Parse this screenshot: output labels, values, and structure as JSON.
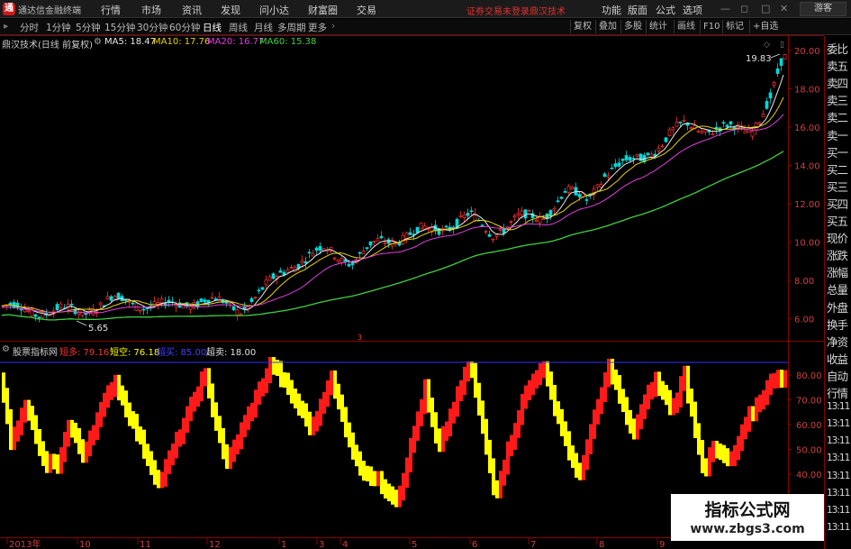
{
  "app": {
    "title": "通达信金融终端",
    "logo": "通",
    "menu": [
      "行情",
      "市场",
      "资讯",
      "发现",
      "问小达",
      "财富圈",
      "交易"
    ],
    "login_status": "证券交易未登录",
    "brand": "鼎汉技术",
    "right_menu": [
      "功能",
      "版面",
      "公式",
      "选项"
    ],
    "guest": "游客"
  },
  "tabs": {
    "periods": [
      "分时",
      "1分钟",
      "5分钟",
      "15分钟",
      "30分钟",
      "60分钟",
      "日线",
      "周线",
      "月线",
      "多周期",
      "更多"
    ],
    "active": "日线",
    "buttons": [
      "复权",
      "叠加",
      "多股",
      "统计",
      "画线",
      "F10",
      "标记",
      "+自选"
    ]
  },
  "chart": {
    "stock_title": "鼎汉技术(日线 前复权)",
    "ma": [
      {
        "label": "MA5: 18.47",
        "color": "#e8e8e8"
      },
      {
        "label": "MA10: 17.76",
        "color": "#e8d200"
      },
      {
        "label": "MA20: 16.77",
        "color": "#e040e0"
      },
      {
        "label": "MA60: 15.38",
        "color": "#40d040"
      }
    ],
    "high_label": "19.83",
    "low_label": "5.65",
    "marker_label": "3"
  },
  "price_axis": [
    "20.00",
    "18.00",
    "16.00",
    "14.00",
    "12.00",
    "10.00",
    "8.00",
    "6.00"
  ],
  "indicator": {
    "title": "股票指标网",
    "items": [
      {
        "label": "短多: 79.16",
        "color": "#ff3030"
      },
      {
        "label": "短空: 76.18",
        "color": "#ffff00"
      },
      {
        "label": "超买: 85.00",
        "color": "#4040ff"
      },
      {
        "label": "超卖: 18.00",
        "color": "#e0e0e0"
      }
    ],
    "axis": [
      "80.00",
      "70.00",
      "60.00",
      "50.00",
      "40.00"
    ]
  },
  "date_axis": [
    "2013年",
    "10",
    "11",
    "12",
    "1",
    "3",
    "4",
    "5",
    "6",
    "7",
    "8",
    "9"
  ],
  "right_panel": [
    "委比",
    "卖五",
    "卖四",
    "卖三",
    "卖二",
    "卖一",
    "买一",
    "买二",
    "买三",
    "买四",
    "买五",
    "现价",
    "涨跌",
    "涨幅",
    "总量",
    "外盘",
    "换手",
    "净资",
    "收益",
    "自动",
    "行情",
    "13:11",
    "13:11",
    "13:11",
    "13:11",
    "13:11",
    "13:11",
    "13:11",
    "13:11"
  ],
  "watermark": {
    "title": "指标公式网",
    "url": "www.zbgs3.com"
  }
}
